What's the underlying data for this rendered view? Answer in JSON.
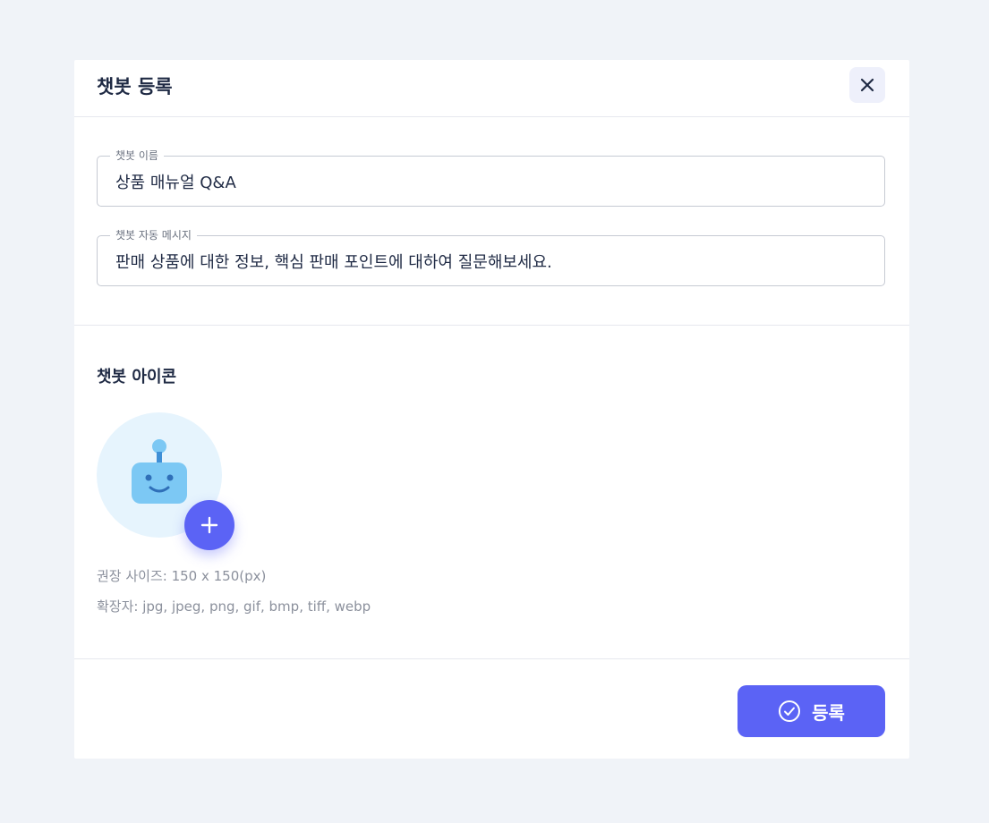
{
  "modal": {
    "title": "챗봇 등록",
    "close_icon": "close-icon"
  },
  "fields": {
    "name": {
      "legend": "챗봇 이름",
      "value": "상품 매뉴얼 Q&A"
    },
    "auto_message": {
      "legend": "챗봇 자동 메시지",
      "value": "판매 상품에 대한 정보, 핵심 판매 포인트에 대하여 질문해보세요."
    }
  },
  "icon_section": {
    "title": "챗봇 아이콘",
    "avatar_icon": "robot-icon",
    "add_icon": "plus-icon",
    "recommended_size": "권장 사이즈: 150 x 150(px)",
    "extensions": "확장자: jpg, jpeg, png, gif, bmp, tiff, webp"
  },
  "footer": {
    "submit_label": "등록",
    "submit_icon": "check-circle-icon"
  },
  "colors": {
    "accent": "#5b63f5",
    "background": "#f0f3f8",
    "avatar_bg": "#e6f4fd",
    "robot": "#7cc8f4"
  }
}
